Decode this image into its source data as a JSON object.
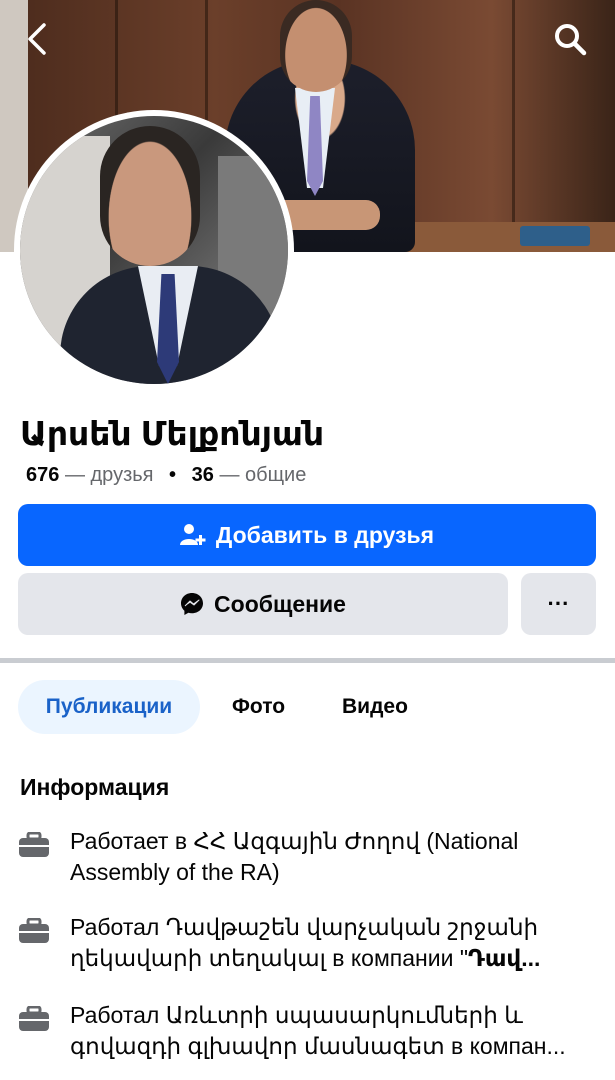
{
  "header": {
    "back_icon": "chevron-left-icon",
    "search_icon": "search-icon"
  },
  "profile": {
    "name": "Արսեն Մելքոնյան",
    "friends_count": "676",
    "friends_label": "— друзья",
    "separator": "•",
    "mutual_count": "36",
    "mutual_label": "— общие"
  },
  "actions": {
    "add_friend_label": "Добавить в друзья",
    "message_label": "Сообщение",
    "more_label": "···"
  },
  "tabs": [
    {
      "label": "Публикации",
      "active": true
    },
    {
      "label": "Фото",
      "active": false
    },
    {
      "label": "Видео",
      "active": false
    }
  ],
  "info": {
    "title": "Информация",
    "items": [
      {
        "line1": "Работает в ՀՀ Ազգային Ժողով (National",
        "line2": "Assembly of the RA)"
      },
      {
        "line1": "Работал Դավթաշեն վարչական շրջանի",
        "line2_prefix": "ղեկավարի տեղակալ в компании \"",
        "line2_strong": "Դավ..."
      },
      {
        "line1": "Работал Առևտրի սպասարկումների և",
        "line2_prefix": "գովազդի գլխավոր մասնագետ в компан..."
      }
    ]
  },
  "colors": {
    "primary": "#0866ff",
    "tab_active_bg": "#ebf5ff",
    "tab_active_text": "#1a62c8",
    "secondary_button": "#e4e6eb"
  }
}
